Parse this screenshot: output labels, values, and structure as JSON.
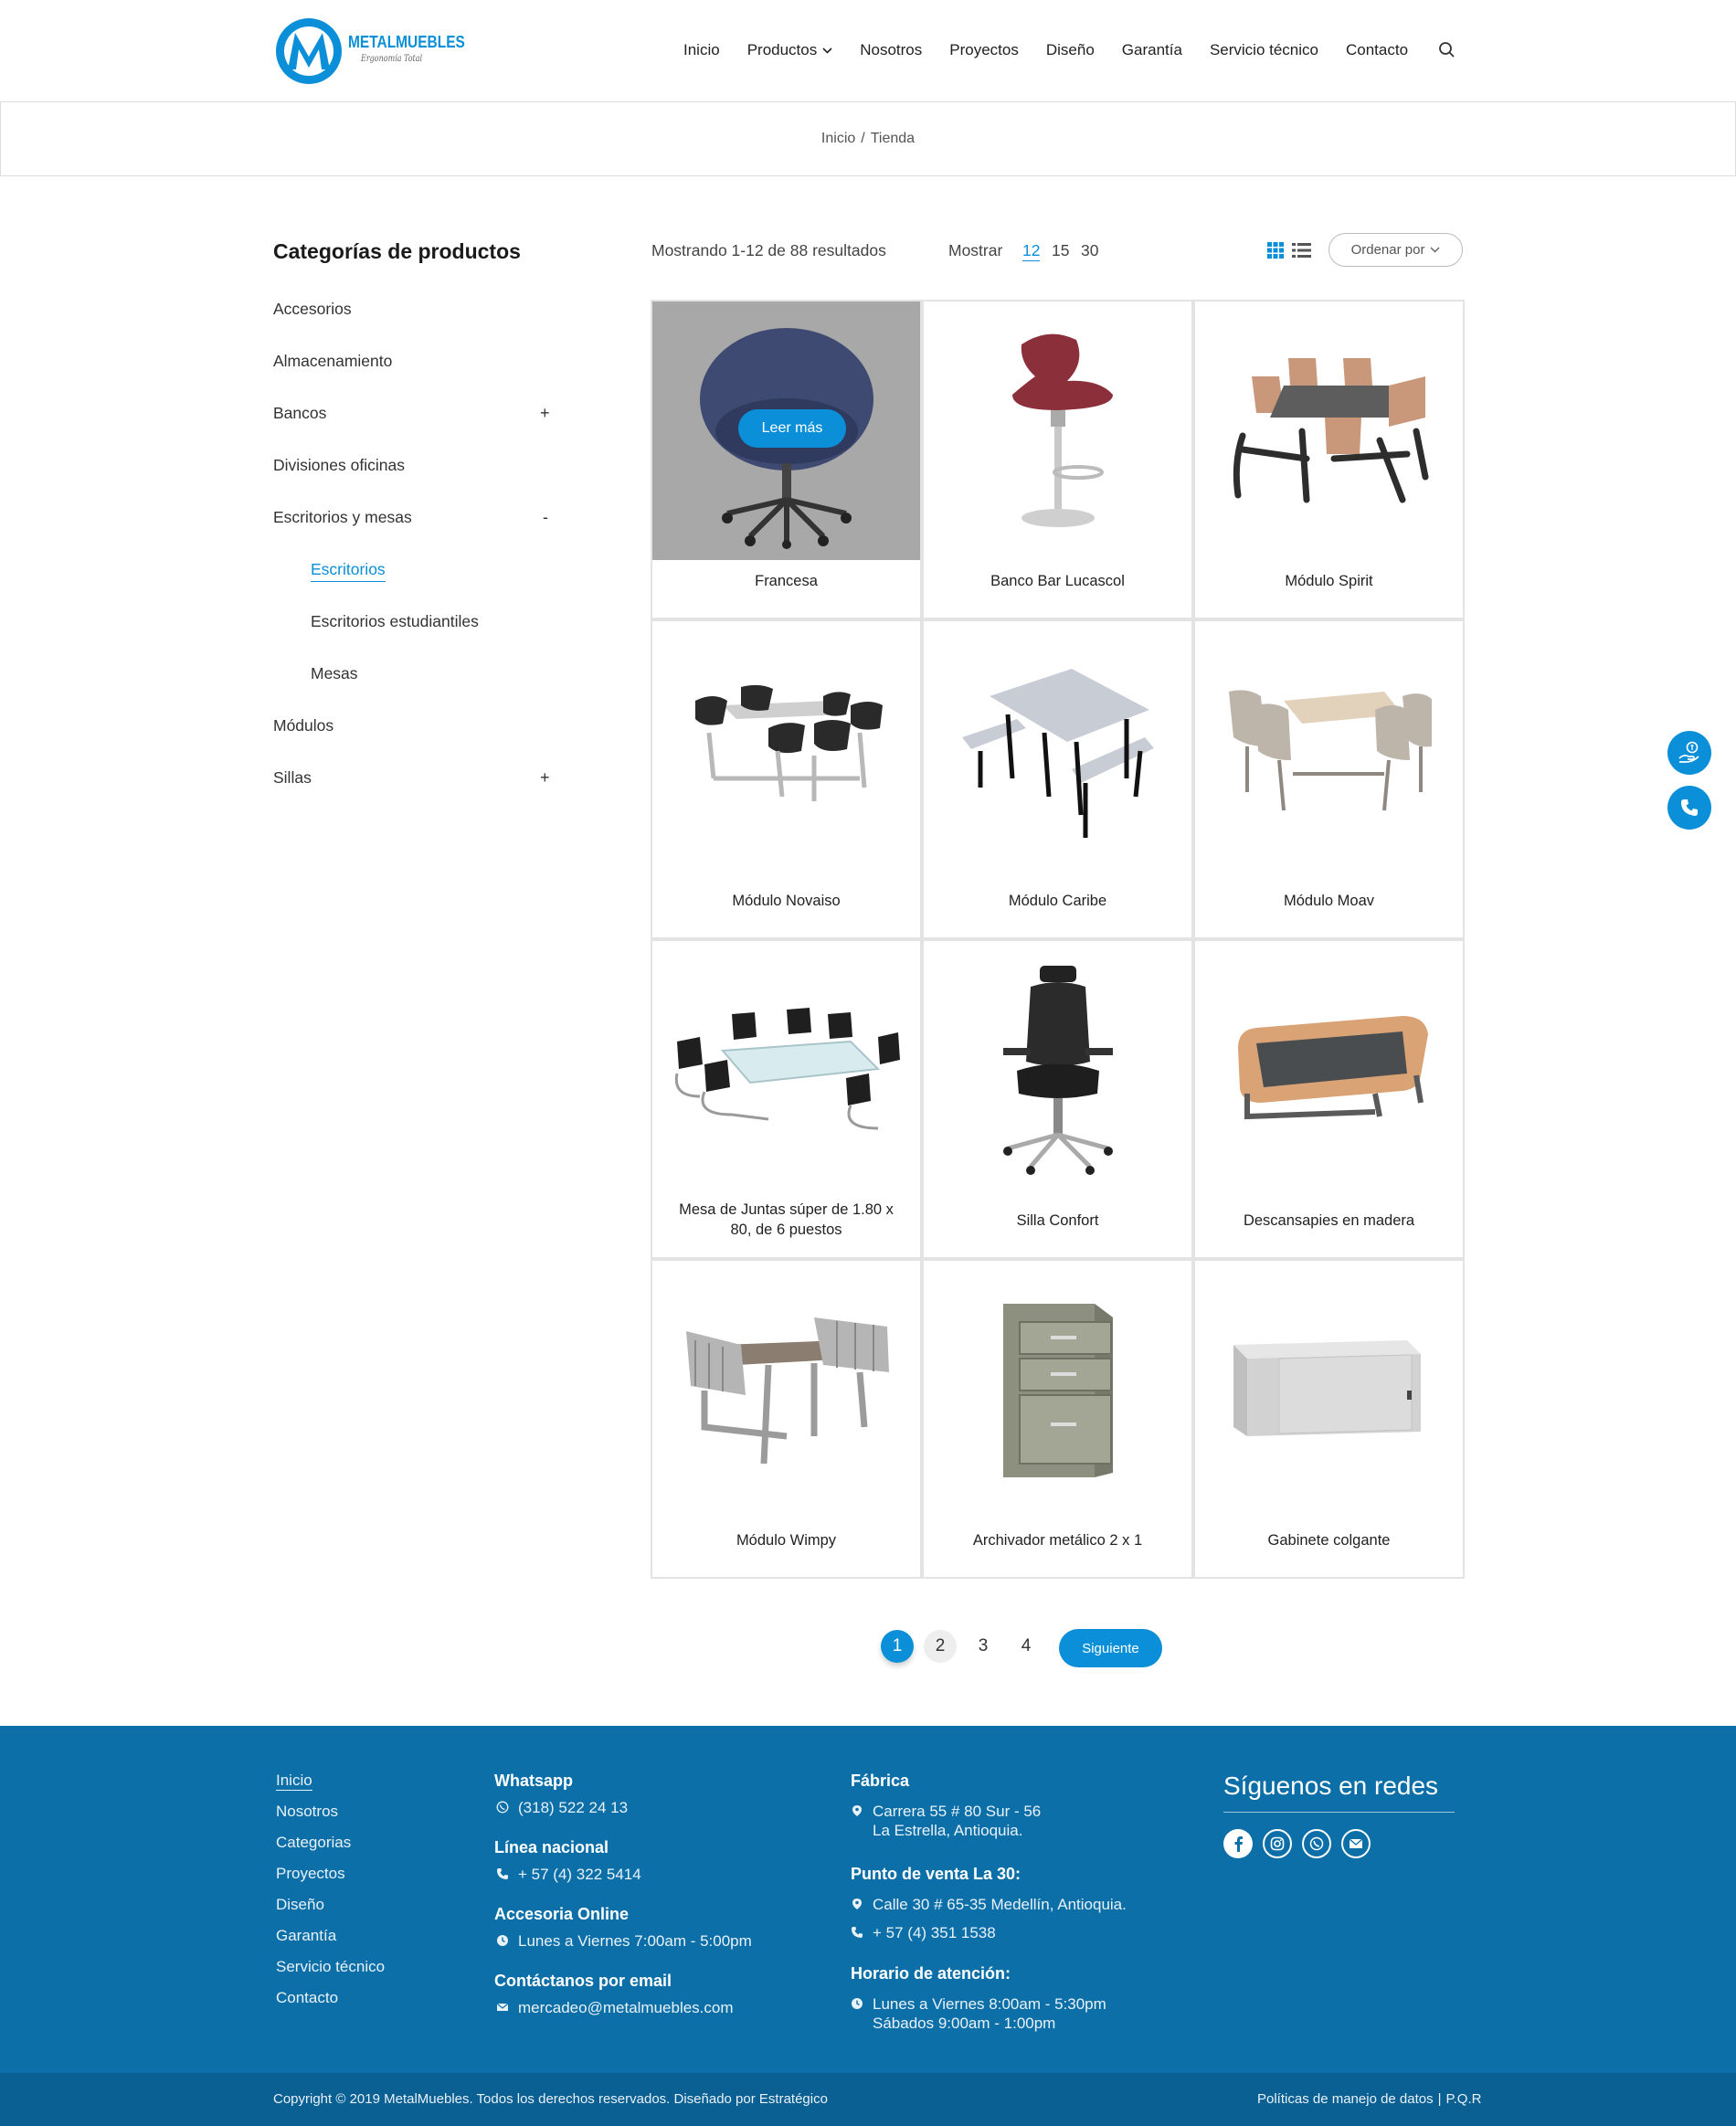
{
  "brand": {
    "name": "METALMUEBLES",
    "tagline": "Ergonomía Total"
  },
  "nav": {
    "items": [
      {
        "label": "Inicio"
      },
      {
        "label": "Productos"
      },
      {
        "label": "Nosotros"
      },
      {
        "label": "Proyectos"
      },
      {
        "label": "Diseño"
      },
      {
        "label": "Garantía"
      },
      {
        "label": "Servicio técnico"
      },
      {
        "label": "Contacto"
      }
    ]
  },
  "breadcrumb": {
    "home": "Inicio",
    "sep": "/",
    "current": "Tienda"
  },
  "sidebar": {
    "title": "Categorías de productos",
    "categories": [
      {
        "label": "Accesorios"
      },
      {
        "label": "Almacenamiento"
      },
      {
        "label": "Bancos",
        "toggle": "+"
      },
      {
        "label": "Divisiones oficinas"
      },
      {
        "label": "Escritorios y mesas",
        "toggle": "-"
      },
      {
        "label": "Escritorios"
      },
      {
        "label": "Escritorios estudiantiles"
      },
      {
        "label": "Mesas"
      },
      {
        "label": "Módulos"
      },
      {
        "label": "Sillas",
        "toggle": "+"
      }
    ]
  },
  "toolbar": {
    "result_count": "Mostrando 1-12 de 88 resultados",
    "show_label": "Mostrar",
    "show_options": [
      "12",
      "15",
      "30"
    ],
    "sort_label": "Ordenar por"
  },
  "products": [
    {
      "name": "Francesa",
      "hover_label": "Leer más"
    },
    {
      "name": "Banco Bar Lucascol"
    },
    {
      "name": "Módulo Spirit"
    },
    {
      "name": "Módulo Novaiso"
    },
    {
      "name": "Módulo Caribe"
    },
    {
      "name": "Módulo Moav"
    },
    {
      "name": "Mesa de Juntas súper de 1.80 x 80, de 6 puestos"
    },
    {
      "name": "Silla Confort"
    },
    {
      "name": "Descansapies en madera"
    },
    {
      "name": "Módulo Wimpy"
    },
    {
      "name": "Archivador metálico 2 x 1"
    },
    {
      "name": "Gabinete colgante"
    }
  ],
  "pagination": {
    "pages": [
      "1",
      "2",
      "3",
      "4"
    ],
    "next": "Siguiente"
  },
  "footer": {
    "links": [
      "Inicio",
      "Nosotros",
      "Categorias",
      "Proyectos",
      "Diseño",
      "Garantía",
      "Servicio técnico",
      "Contacto"
    ],
    "whatsapp": {
      "title": "Whatsapp",
      "value": "(318) 522 24 13"
    },
    "linea": {
      "title": "Línea nacional",
      "value": "+ 57 (4) 322 5414"
    },
    "accesoria": {
      "title": "Accesoria Online",
      "value": "Lunes a Viernes 7:00am - 5:00pm"
    },
    "email": {
      "title": "Contáctanos por email",
      "value": "mercadeo@metalmuebles.com"
    },
    "fabrica": {
      "title": "Fábrica",
      "line1": "Carrera 55 # 80 Sur - 56",
      "line2": "La Estrella, Antioquia."
    },
    "punto": {
      "title": "Punto de venta La 30:",
      "address": "Calle 30 # 65-35 Medellín, Antioquia.",
      "phone": "+ 57 (4) 351 1538"
    },
    "horario": {
      "title": "Horario de atención:",
      "line1": "Lunes a Viernes 8:00am - 5:30pm",
      "line2": "Sábados 9:00am - 1:00pm"
    },
    "social_title": "Síguenos en redes",
    "copyright": "Copyright © 2019 MetalMuebles. Todos los derechos reservados. Diseñado por Estratégico",
    "policy": "Políticas de manejo de datos",
    "sep": "|",
    "pqr": "P.Q.R"
  },
  "colors": {
    "accent": "#0a8fd8",
    "footer_bg": "#0d6fa8",
    "copy_bg": "#0a5f93"
  }
}
